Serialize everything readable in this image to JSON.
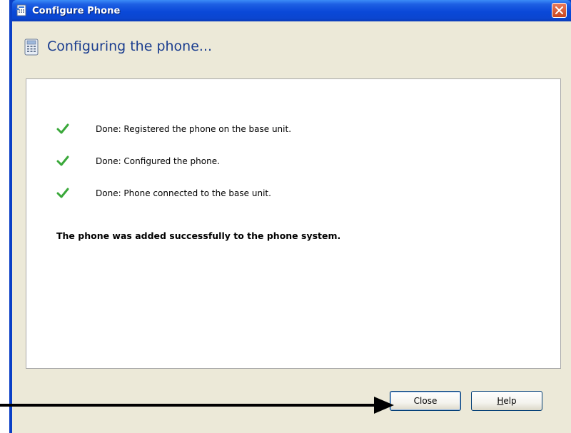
{
  "window": {
    "title": "Configure Phone",
    "header_title": "Configuring the phone..."
  },
  "steps": [
    {
      "status": "done",
      "text": "Done: Registered the phone on the base unit."
    },
    {
      "status": "done",
      "text": "Done: Configured the phone."
    },
    {
      "status": "done",
      "text": "Done: Phone connected to the base unit."
    }
  ],
  "message": "The phone was added successfully to the phone system.",
  "buttons": {
    "close_label": "Close",
    "help_label_underlined": "H",
    "help_label_rest": "elp"
  },
  "colors": {
    "titlebar": "#0a48d8",
    "header_text": "#1a3d8f",
    "check": "#3aa83a",
    "client_bg": "#ece9d8"
  },
  "icons": {
    "title": "configure-phone-icon",
    "header": "phone-icon",
    "close": "close-icon",
    "step": "checkmark-icon",
    "annotation": "arrow-icon"
  }
}
